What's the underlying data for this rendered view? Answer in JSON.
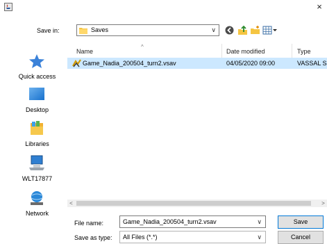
{
  "titlebar": {
    "close_glyph": "×"
  },
  "save_in": {
    "label": "Save in:",
    "value": "Saves"
  },
  "places": [
    {
      "label": "Quick access",
      "icon": "star-icon"
    },
    {
      "label": "Desktop",
      "icon": "desktop-icon"
    },
    {
      "label": "Libraries",
      "icon": "libraries-icon"
    },
    {
      "label": "WLT17877",
      "icon": "computer-icon"
    },
    {
      "label": "Network",
      "icon": "network-icon"
    }
  ],
  "columns": {
    "name": "Name",
    "date": "Date modified",
    "type": "Type"
  },
  "files": [
    {
      "name": "Game_Nadia_200504_turn2.vsav",
      "date": "04/05/2020 09:00",
      "type": "VASSAL Sa",
      "selected": true
    }
  ],
  "file_name": {
    "label": "File name:",
    "value": "Game_Nadia_200504_turn2.vsav"
  },
  "file_type": {
    "label": "Save as type:",
    "value": "All Files (*.*)"
  },
  "buttons": {
    "save": "Save",
    "cancel": "Cancel"
  },
  "colors": {
    "selection": "#cce8ff",
    "accent": "#0078d7"
  }
}
